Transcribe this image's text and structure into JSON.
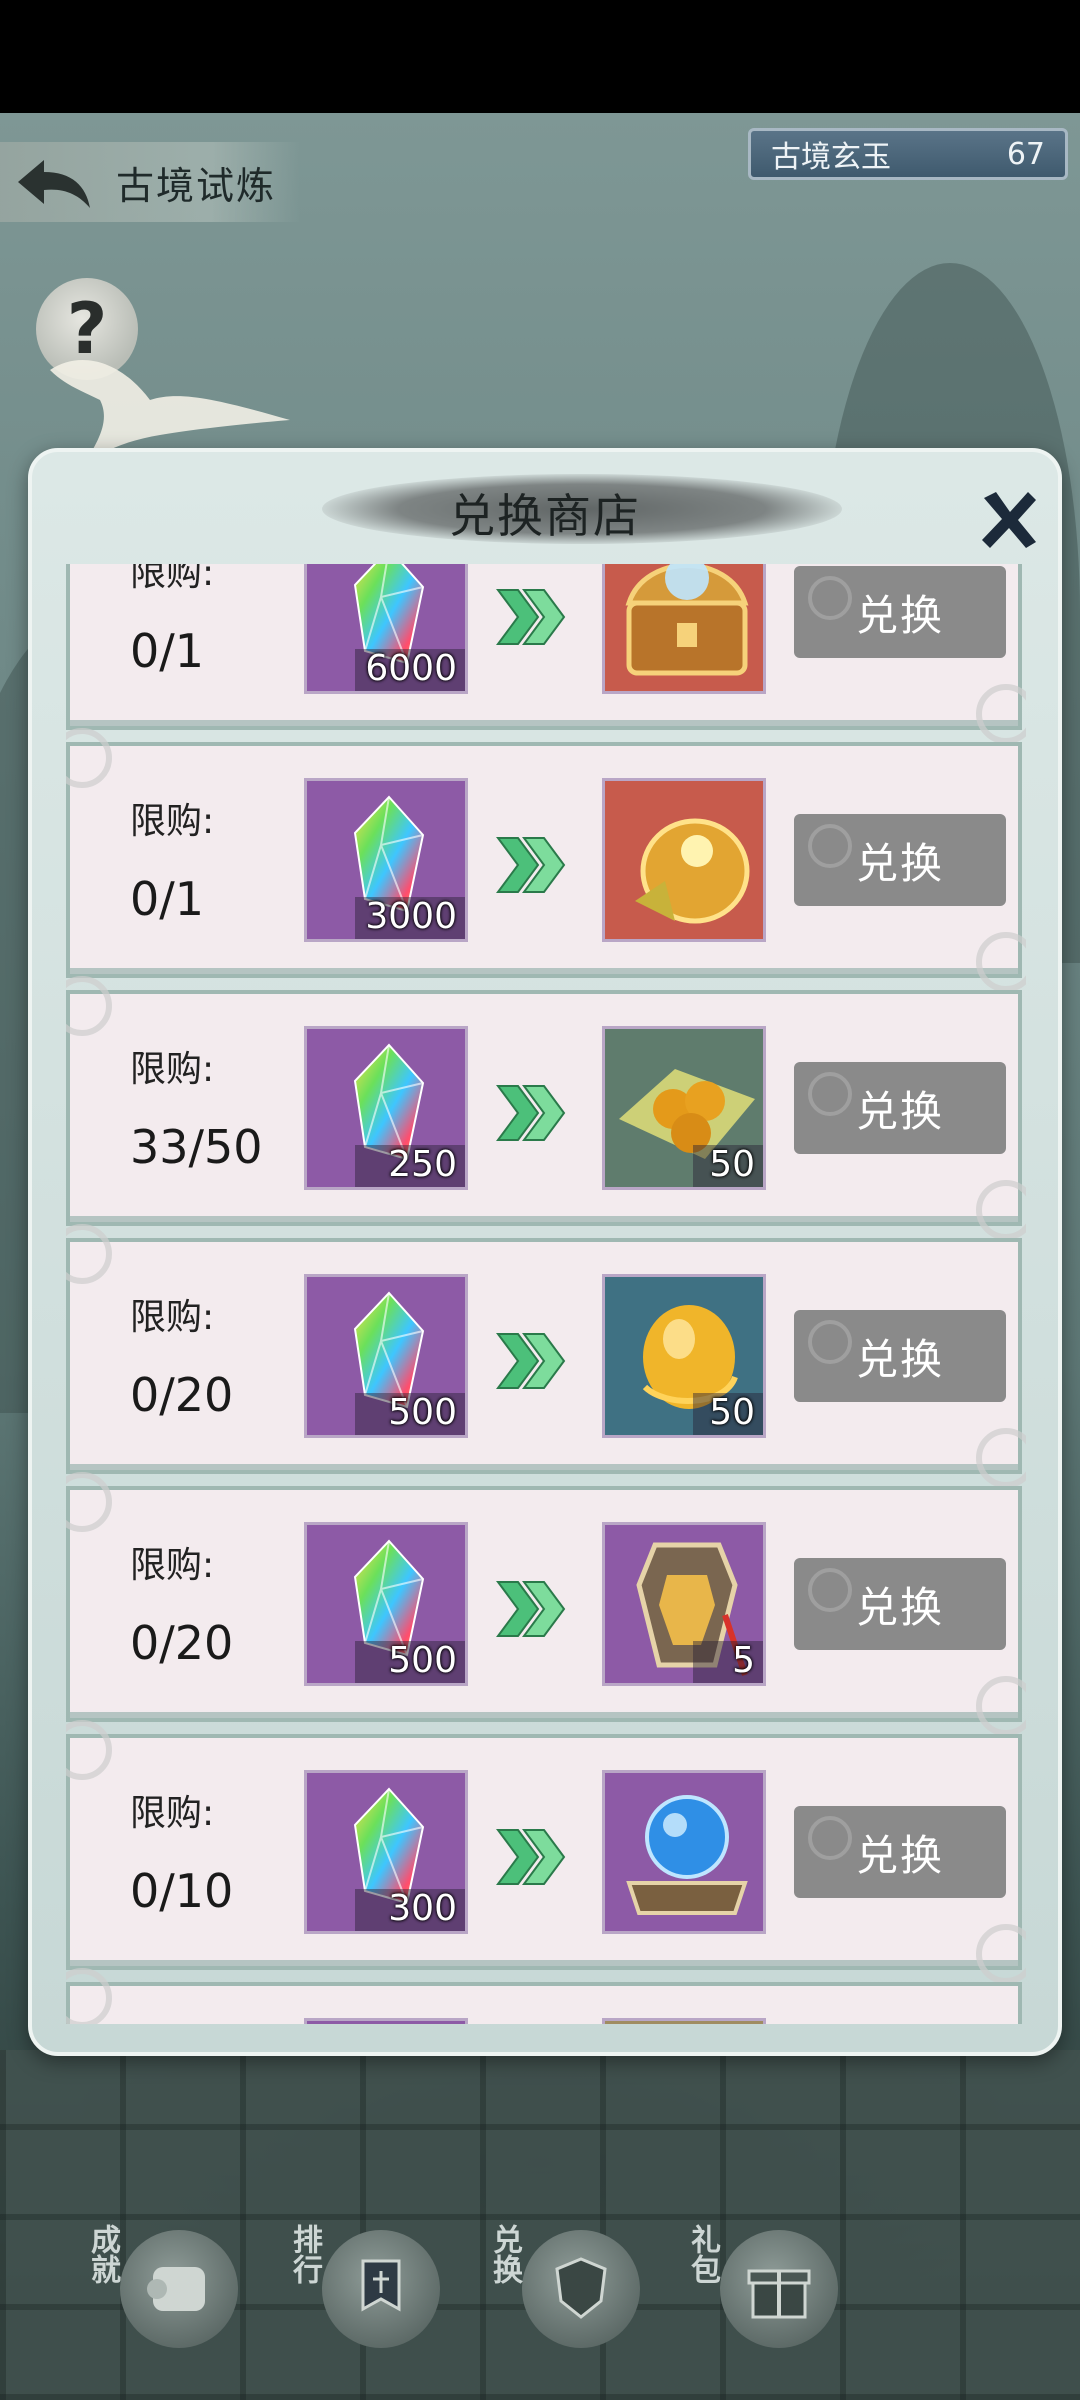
{
  "header": {
    "back_title": "古境试炼",
    "currency_name": "古境玄玉",
    "currency_value": "67",
    "help_symbol": "?"
  },
  "panel": {
    "title": "兑换商店",
    "limit_label": "限购:",
    "exchange_label": "兑换",
    "rows": [
      {
        "limit": "0/1",
        "cost": "6000",
        "reward_icon": "treasure-chest-icon",
        "reward_qty": "",
        "reward_bg": "#c75b4c"
      },
      {
        "limit": "0/1",
        "cost": "3000",
        "reward_icon": "gold-treasure-bag-icon",
        "reward_qty": "",
        "reward_bg": "#c75b4c"
      },
      {
        "limit": "33/50",
        "cost": "250",
        "reward_icon": "golden-pills-icon",
        "reward_qty": "50",
        "reward_bg": "#5f7c6d"
      },
      {
        "limit": "0/20",
        "cost": "500",
        "reward_icon": "golden-orb-icon",
        "reward_qty": "50",
        "reward_bg": "#3f7183"
      },
      {
        "limit": "0/20",
        "cost": "500",
        "reward_icon": "phoenix-token-icon",
        "reward_qty": "5",
        "reward_bg": "#8d5aa6"
      },
      {
        "limit": "0/10",
        "cost": "300",
        "reward_icon": "crystal-ball-icon",
        "reward_qty": "",
        "reward_bg": "#8d5aa6"
      }
    ]
  },
  "bottom_nav": [
    {
      "label": "成就",
      "icon": "scroll-icon"
    },
    {
      "label": "排行",
      "icon": "banner-icon"
    },
    {
      "label": "兑换",
      "icon": "shield-emblem-icon"
    },
    {
      "label": "礼包",
      "icon": "gift-box-icon"
    }
  ],
  "colors": {
    "cost_slot": "#8d5aa6",
    "exchange_button": "#8a8a8a",
    "arrow": "#4cc07a"
  }
}
